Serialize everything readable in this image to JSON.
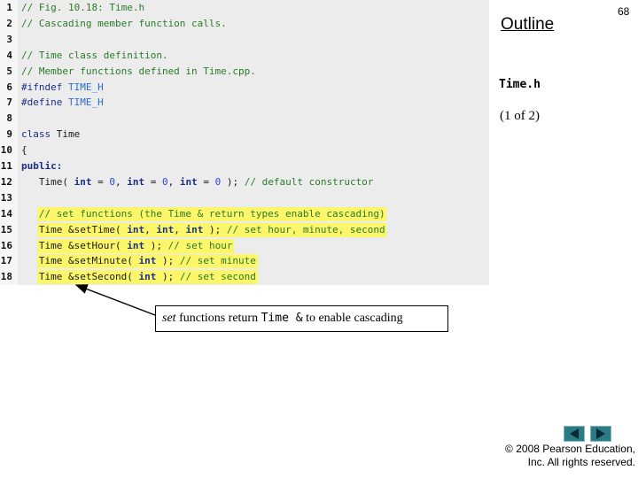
{
  "slide_number": "68",
  "outline_label": "Outline",
  "file_name": "Time.h",
  "page_of": "(1 of 2)",
  "callout": {
    "italic": "set",
    "text1": " functions return ",
    "code": "Time &",
    "text2": " to enable cascading"
  },
  "copyright": {
    "line1": "© 2008 Pearson Education,",
    "line2": "Inc.  All rights reserved."
  },
  "nav": {
    "prev": "previous-slide",
    "next": "next-slide"
  },
  "colors": {
    "highlight": "#fbf66a",
    "comment": "#2a7a2a",
    "keyword": "#1a2e8a",
    "number": "#2a4ad0",
    "nav": "#2a7b86"
  },
  "code_lines": [
    {
      "num": "1",
      "highlight": false,
      "tokens": [
        {
          "t": "// Fig. 10.18: Time.h",
          "c": "comment"
        }
      ]
    },
    {
      "num": "2",
      "highlight": false,
      "tokens": [
        {
          "t": "// Cascading member function calls.",
          "c": "comment"
        }
      ]
    },
    {
      "num": "3",
      "highlight": false,
      "tokens": []
    },
    {
      "num": "4",
      "highlight": false,
      "tokens": [
        {
          "t": "// Time class definition.",
          "c": "comment"
        }
      ]
    },
    {
      "num": "5",
      "highlight": false,
      "tokens": [
        {
          "t": "// Member functions defined in Time.cpp.",
          "c": "comment"
        }
      ]
    },
    {
      "num": "6",
      "highlight": false,
      "tokens": [
        {
          "t": "#ifndef ",
          "c": "kwn"
        },
        {
          "t": "TIME_H",
          "c": "macro"
        }
      ]
    },
    {
      "num": "7",
      "highlight": false,
      "tokens": [
        {
          "t": "#define ",
          "c": "kwn"
        },
        {
          "t": "TIME_H",
          "c": "macro"
        }
      ]
    },
    {
      "num": "8",
      "highlight": false,
      "tokens": []
    },
    {
      "num": "9",
      "highlight": false,
      "tokens": [
        {
          "t": "class",
          "c": "kwn"
        },
        {
          "t": " Time",
          "c": "normal"
        }
      ]
    },
    {
      "num": "10",
      "highlight": false,
      "tokens": [
        {
          "t": "{",
          "c": "normal"
        }
      ]
    },
    {
      "num": "11",
      "highlight": false,
      "tokens": [
        {
          "t": "public:",
          "c": "kw"
        }
      ]
    },
    {
      "num": "12",
      "highlight": false,
      "tokens": [
        {
          "t": "   Time( ",
          "c": "normal"
        },
        {
          "t": "int",
          "c": "kw"
        },
        {
          "t": " = ",
          "c": "normal"
        },
        {
          "t": "0",
          "c": "num"
        },
        {
          "t": ", ",
          "c": "normal"
        },
        {
          "t": "int",
          "c": "kw"
        },
        {
          "t": " = ",
          "c": "normal"
        },
        {
          "t": "0",
          "c": "num"
        },
        {
          "t": ", ",
          "c": "normal"
        },
        {
          "t": "int",
          "c": "kw"
        },
        {
          "t": " = ",
          "c": "normal"
        },
        {
          "t": "0",
          "c": "num"
        },
        {
          "t": " ); ",
          "c": "normal"
        },
        {
          "t": "// default constructor",
          "c": "comment"
        }
      ]
    },
    {
      "num": "13",
      "highlight": false,
      "tokens": []
    },
    {
      "num": "14",
      "highlight": true,
      "tokens": [
        {
          "t": "   // set functions (the Time & return types enable cascading)",
          "c": "comment"
        }
      ]
    },
    {
      "num": "15",
      "highlight": true,
      "tokens": [
        {
          "t": "   Time &setTime( ",
          "c": "normal"
        },
        {
          "t": "int",
          "c": "kw"
        },
        {
          "t": ", ",
          "c": "normal"
        },
        {
          "t": "int",
          "c": "kw"
        },
        {
          "t": ", ",
          "c": "normal"
        },
        {
          "t": "int",
          "c": "kw"
        },
        {
          "t": " ); ",
          "c": "normal"
        },
        {
          "t": "// set hour, minute, second",
          "c": "comment"
        }
      ]
    },
    {
      "num": "16",
      "highlight": true,
      "tokens": [
        {
          "t": "   Time &setHour( ",
          "c": "normal"
        },
        {
          "t": "int",
          "c": "kw"
        },
        {
          "t": " ); ",
          "c": "normal"
        },
        {
          "t": "// set hour",
          "c": "comment"
        }
      ]
    },
    {
      "num": "17",
      "highlight": true,
      "tokens": [
        {
          "t": "   Time &setMinute( ",
          "c": "normal"
        },
        {
          "t": "int",
          "c": "kw"
        },
        {
          "t": " ); ",
          "c": "normal"
        },
        {
          "t": "// set minute",
          "c": "comment"
        }
      ]
    },
    {
      "num": "18",
      "highlight": true,
      "tokens": [
        {
          "t": "   Time &setSecond( ",
          "c": "normal"
        },
        {
          "t": "int",
          "c": "kw"
        },
        {
          "t": " ); ",
          "c": "normal"
        },
        {
          "t": "// set second",
          "c": "comment"
        }
      ]
    }
  ]
}
